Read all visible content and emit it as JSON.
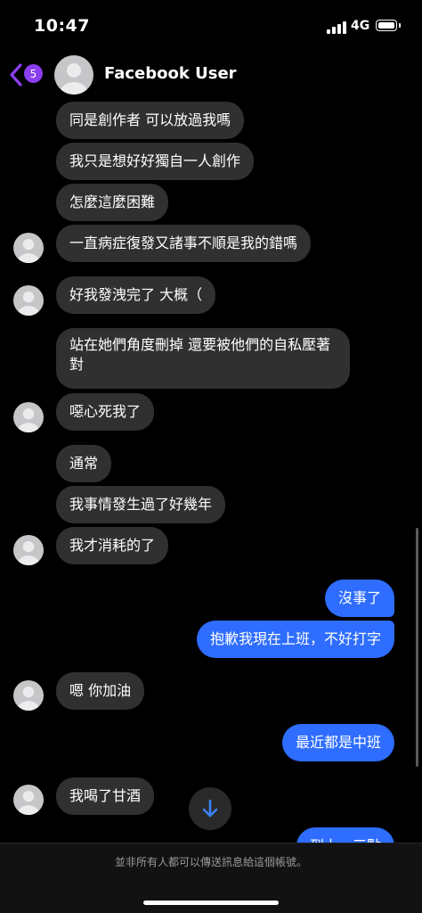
{
  "status_bar": {
    "time": "10:47",
    "network": "4G"
  },
  "header": {
    "back_badge": "5",
    "contact_name": "Facebook User"
  },
  "messages": [
    {
      "side": "in",
      "text": "同是創作者  可以放過我嗎"
    },
    {
      "side": "in",
      "text": "我只是想好好獨自一人創作"
    },
    {
      "side": "in",
      "text": "怎麼這麼困難"
    },
    {
      "side": "in",
      "text": "一直病症復發又諸事不順是我的錯嗎"
    },
    {
      "side": "in",
      "text": "好我發洩完了 大概（"
    },
    {
      "side": "in",
      "text": "站在她們角度刪掉 還要被他們的自私壓著 對"
    },
    {
      "side": "in",
      "text": "噁心死我了"
    },
    {
      "side": "in",
      "text": "通常"
    },
    {
      "side": "in",
      "text": "我事情發生過了好幾年"
    },
    {
      "side": "in",
      "text": "我才消耗的了"
    },
    {
      "side": "out",
      "text": "沒事了"
    },
    {
      "side": "out",
      "text": "抱歉我現在上班，不好打字"
    },
    {
      "side": "in",
      "text": "嗯 你加油"
    },
    {
      "side": "out",
      "text": "最近都是中班"
    },
    {
      "side": "in",
      "text": "我喝了甘酒"
    },
    {
      "side": "out",
      "text": "到上一三點"
    }
  ],
  "footer": {
    "notice": "並非所有人都可以傳送訊息給這個帳號。"
  },
  "icons": {
    "back": "chevron-left-icon",
    "scroll_down": "arrow-down-icon",
    "avatar": "default-person-avatar"
  },
  "colors": {
    "background": "#000000",
    "incoming_bubble": "#303030",
    "outgoing_bubble": "#2e6dff",
    "accent": "#8b3ef0"
  }
}
